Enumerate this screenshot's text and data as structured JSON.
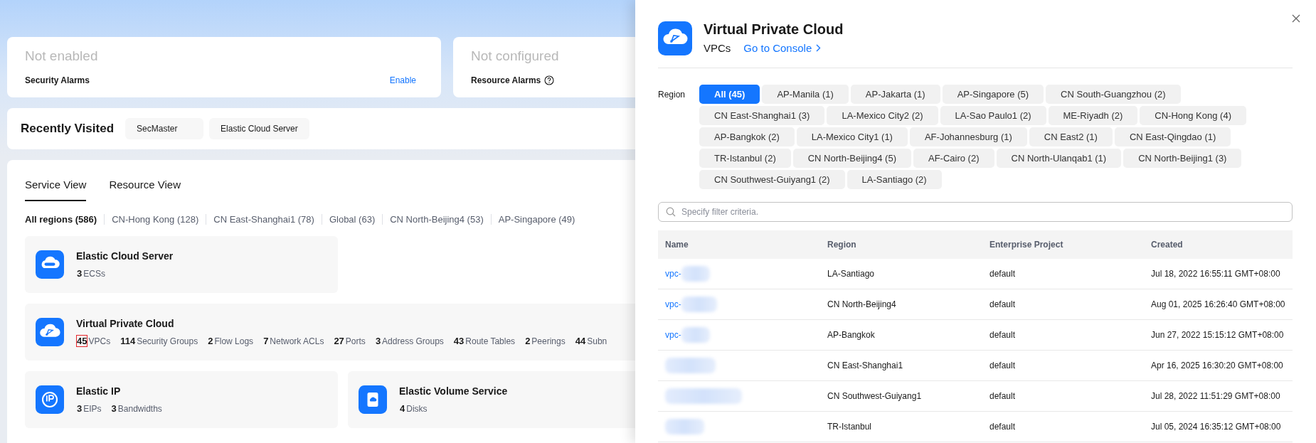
{
  "header_cards": [
    {
      "status": "Not enabled",
      "label": "Security Alarms",
      "action": "Enable",
      "help": false
    },
    {
      "status": "Not configured",
      "label": "Resource Alarms",
      "help": true
    }
  ],
  "recently_visited": {
    "title": "Recently Visited",
    "items": [
      "SecMaster",
      "Elastic Cloud Server"
    ]
  },
  "view_tabs": [
    {
      "label": "Service View",
      "selected": true
    },
    {
      "label": "Resource View",
      "selected": false
    }
  ],
  "region_filters": [
    {
      "label": "All regions (586)",
      "selected": true
    },
    {
      "label": "CN-Hong Kong (128)",
      "selected": false
    },
    {
      "label": "CN East-Shanghai1 (78)",
      "selected": false
    },
    {
      "label": "Global (63)",
      "selected": false
    },
    {
      "label": "CN North-Beijing4 (53)",
      "selected": false
    },
    {
      "label": "AP-Singapore (49)",
      "selected": false
    }
  ],
  "service_rows": [
    [
      {
        "name": "Elastic Cloud Server",
        "kind": "ecs",
        "stats": [
          {
            "count": "3",
            "label": "ECSs",
            "highlighted": false
          }
        ]
      }
    ],
    [
      {
        "name": "Virtual Private Cloud",
        "kind": "vpc",
        "stats": [
          {
            "count": "45",
            "label": "VPCs",
            "highlighted": true
          },
          {
            "count": "114",
            "label": "Security Groups",
            "highlighted": false
          },
          {
            "count": "2",
            "label": "Flow Logs",
            "highlighted": false
          },
          {
            "count": "7",
            "label": "Network ACLs",
            "highlighted": false
          },
          {
            "count": "27",
            "label": "Ports",
            "highlighted": false
          },
          {
            "count": "3",
            "label": "Address Groups",
            "highlighted": false
          },
          {
            "count": "43",
            "label": "Route Tables",
            "highlighted": false
          },
          {
            "count": "2",
            "label": "Peerings",
            "highlighted": false
          },
          {
            "count": "44",
            "label": "Subn",
            "highlighted": false
          }
        ]
      }
    ],
    [
      {
        "name": "Elastic IP",
        "kind": "eip",
        "stats": [
          {
            "count": "3",
            "label": "EIPs",
            "highlighted": false
          },
          {
            "count": "3",
            "label": "Bandwidths",
            "highlighted": false
          }
        ]
      },
      {
        "name": "Elastic Volume Service",
        "kind": "evs",
        "stats": [
          {
            "count": "4",
            "label": "Disks",
            "highlighted": false
          }
        ]
      }
    ]
  ],
  "drawer": {
    "kind": "vpc",
    "title": "Virtual Private Cloud",
    "subtitle": "VPCs",
    "console_link": "Go to Console",
    "region_label": "Region",
    "regions": [
      {
        "label": "All (45)",
        "selected": true
      },
      {
        "label": "AP-Manila (1)",
        "selected": false
      },
      {
        "label": "AP-Jakarta (1)",
        "selected": false
      },
      {
        "label": "AP-Singapore (5)",
        "selected": false
      },
      {
        "label": "CN South-Guangzhou (2)",
        "selected": false
      },
      {
        "label": "CN East-Shanghai1 (3)",
        "selected": false
      },
      {
        "label": "LA-Mexico City2 (2)",
        "selected": false
      },
      {
        "label": "LA-Sao Paulo1 (2)",
        "selected": false
      },
      {
        "label": "ME-Riyadh (2)",
        "selected": false
      },
      {
        "label": "CN-Hong Kong (4)",
        "selected": false
      },
      {
        "label": "AP-Bangkok (2)",
        "selected": false
      },
      {
        "label": "LA-Mexico City1 (1)",
        "selected": false
      },
      {
        "label": "AF-Johannesburg (1)",
        "selected": false
      },
      {
        "label": "CN East2 (1)",
        "selected": false
      },
      {
        "label": "CN East-Qingdao (1)",
        "selected": false
      },
      {
        "label": "TR-Istanbul (2)",
        "selected": false
      },
      {
        "label": "CN North-Beijing4 (5)",
        "selected": false
      },
      {
        "label": "AF-Cairo (2)",
        "selected": false
      },
      {
        "label": "CN North-Ulanqab1 (1)",
        "selected": false
      },
      {
        "label": "CN North-Beijing1 (3)",
        "selected": false
      },
      {
        "label": "CN Southwest-Guiyang1 (2)",
        "selected": false
      },
      {
        "label": "LA-Santiago (2)",
        "selected": false
      }
    ],
    "search": {
      "placeholder": "Specify filter criteria."
    },
    "table": {
      "columns": [
        "Name",
        "Region",
        "Enterprise Project",
        "Created"
      ],
      "rows": [
        {
          "name": "vpc-",
          "region": "LA-Santiago",
          "project": "default",
          "created": "Jul 18, 2022 16:55:11 GMT+08:00"
        },
        {
          "name": "vpc-",
          "region": "CN North-Beijing4",
          "project": "default",
          "created": "Aug 01, 2025 16:26:40 GMT+08:00"
        },
        {
          "name": "vpc-",
          "region": "AP-Bangkok",
          "project": "default",
          "created": "Jun 27, 2022 15:15:12 GMT+08:00"
        },
        {
          "region": "CN East-Shanghai1",
          "project": "default",
          "created": "Apr 16, 2025 16:30:20 GMT+08:00"
        },
        {
          "region": "CN Southwest-Guiyang1",
          "project": "default",
          "created": "Jul 28, 2022 11:51:29 GMT+08:00"
        },
        {
          "region": "TR-Istanbul",
          "project": "default",
          "created": "Jul 05, 2024 16:35:12 GMT+08:00"
        }
      ]
    }
  }
}
